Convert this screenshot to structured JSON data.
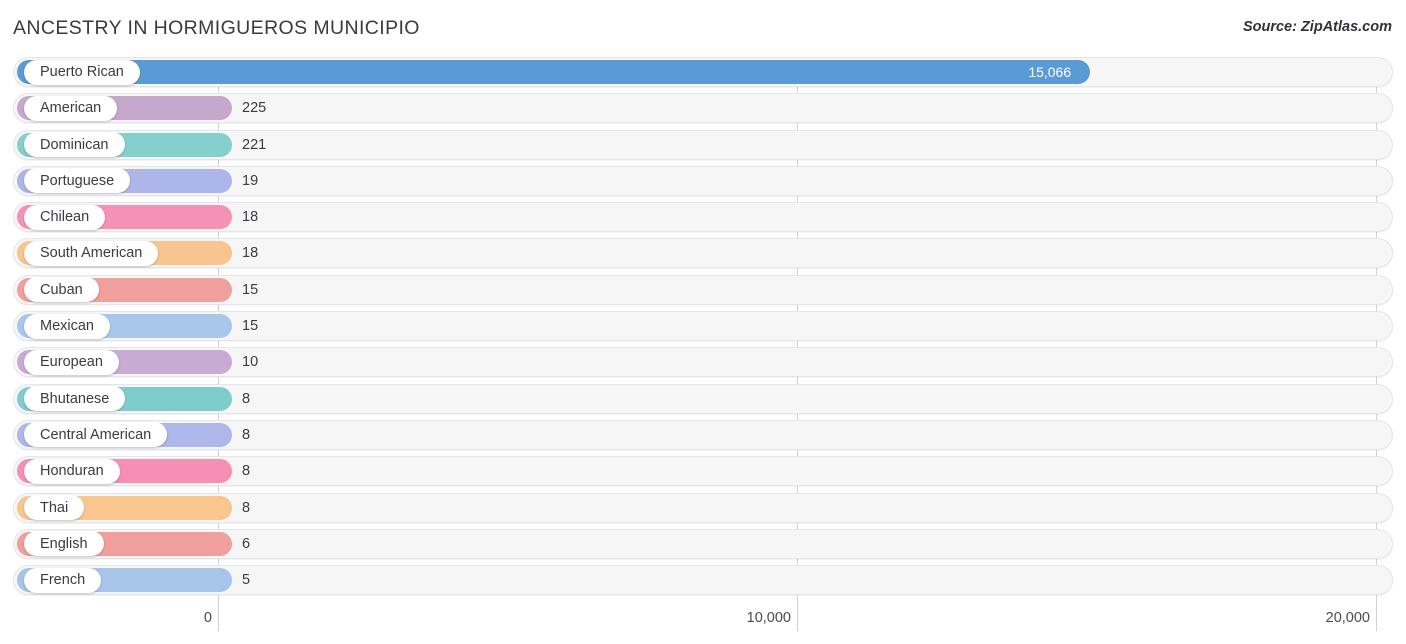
{
  "header": {
    "title": "ANCESTRY IN HORMIGUEROS MUNICIPIO",
    "source": "Source: ZipAtlas.com"
  },
  "chart_data": {
    "type": "bar",
    "orientation": "horizontal",
    "title": "ANCESTRY IN HORMIGUEROS MUNICIPIO",
    "xlabel": "",
    "ylabel": "",
    "xlim": [
      0,
      20000
    ],
    "grid": true,
    "legend": "none",
    "xticks": [
      "0",
      "10,000",
      "20,000"
    ],
    "xtick_values": [
      0,
      10000,
      20000
    ],
    "categories": [
      "Puerto Rican",
      "American",
      "Dominican",
      "Portuguese",
      "Chilean",
      "South American",
      "Cuban",
      "Mexican",
      "European",
      "Bhutanese",
      "Central American",
      "Honduran",
      "Thai",
      "English",
      "French"
    ],
    "values": [
      15066,
      225,
      221,
      19,
      18,
      18,
      15,
      15,
      10,
      8,
      8,
      8,
      8,
      6,
      5
    ],
    "value_labels": [
      "15,066",
      "225",
      "221",
      "19",
      "18",
      "18",
      "15",
      "15",
      "10",
      "8",
      "8",
      "8",
      "8",
      "6",
      "5"
    ],
    "colors": [
      "#5b9bd5",
      "#c6a8cd",
      "#85cfcc",
      "#adb6e8",
      "#f591b5",
      "#f8c490",
      "#ef9f9c",
      "#a9c7ea",
      "#c9aad3",
      "#7fcdcb",
      "#aeb7e9",
      "#f58fb4",
      "#f9c68f",
      "#ef9f9c",
      "#a6c5e9"
    ]
  }
}
